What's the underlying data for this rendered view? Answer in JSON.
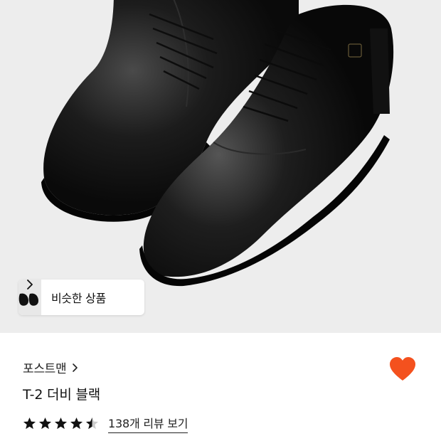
{
  "similar": {
    "label": "비슷한 상품"
  },
  "product": {
    "brand": "포스트맨",
    "name": "T-2 더비 블랙",
    "rating": 4.5,
    "rating_max": 5,
    "review_link": "138개 리뷰 보기"
  },
  "icons": {
    "chevron": "chevron-right-icon",
    "wishlist": "heart-icon",
    "star": "star-icon"
  },
  "colors": {
    "heart": "#F4511E",
    "hero_bg": "#EDEDED",
    "text": "#111111"
  }
}
